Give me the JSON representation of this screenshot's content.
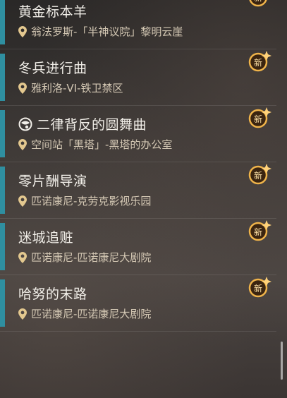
{
  "quests": [
    {
      "title": "黄金标本羊",
      "location": "翁法罗斯-「半神议院」黎明云崖",
      "badge": "新",
      "has_title_icon": false
    },
    {
      "title": "冬兵进行曲",
      "location": "雅利洛-VI-铁卫禁区",
      "badge": "新",
      "has_title_icon": false
    },
    {
      "title": "二律背反的圆舞曲",
      "location": "空间站「黑塔」-黑塔的办公室",
      "badge": "新",
      "has_title_icon": true
    },
    {
      "title": "零片酬导演",
      "location": "匹诺康尼-克劳克影视乐园",
      "badge": "新",
      "has_title_icon": false
    },
    {
      "title": "迷城追赃",
      "location": "匹诺康尼-匹诺康尼大剧院",
      "badge": "新",
      "has_title_icon": false
    },
    {
      "title": "哈努的末路",
      "location": "匹诺康尼-匹诺康尼大剧院",
      "badge": "新",
      "has_title_icon": false
    }
  ]
}
